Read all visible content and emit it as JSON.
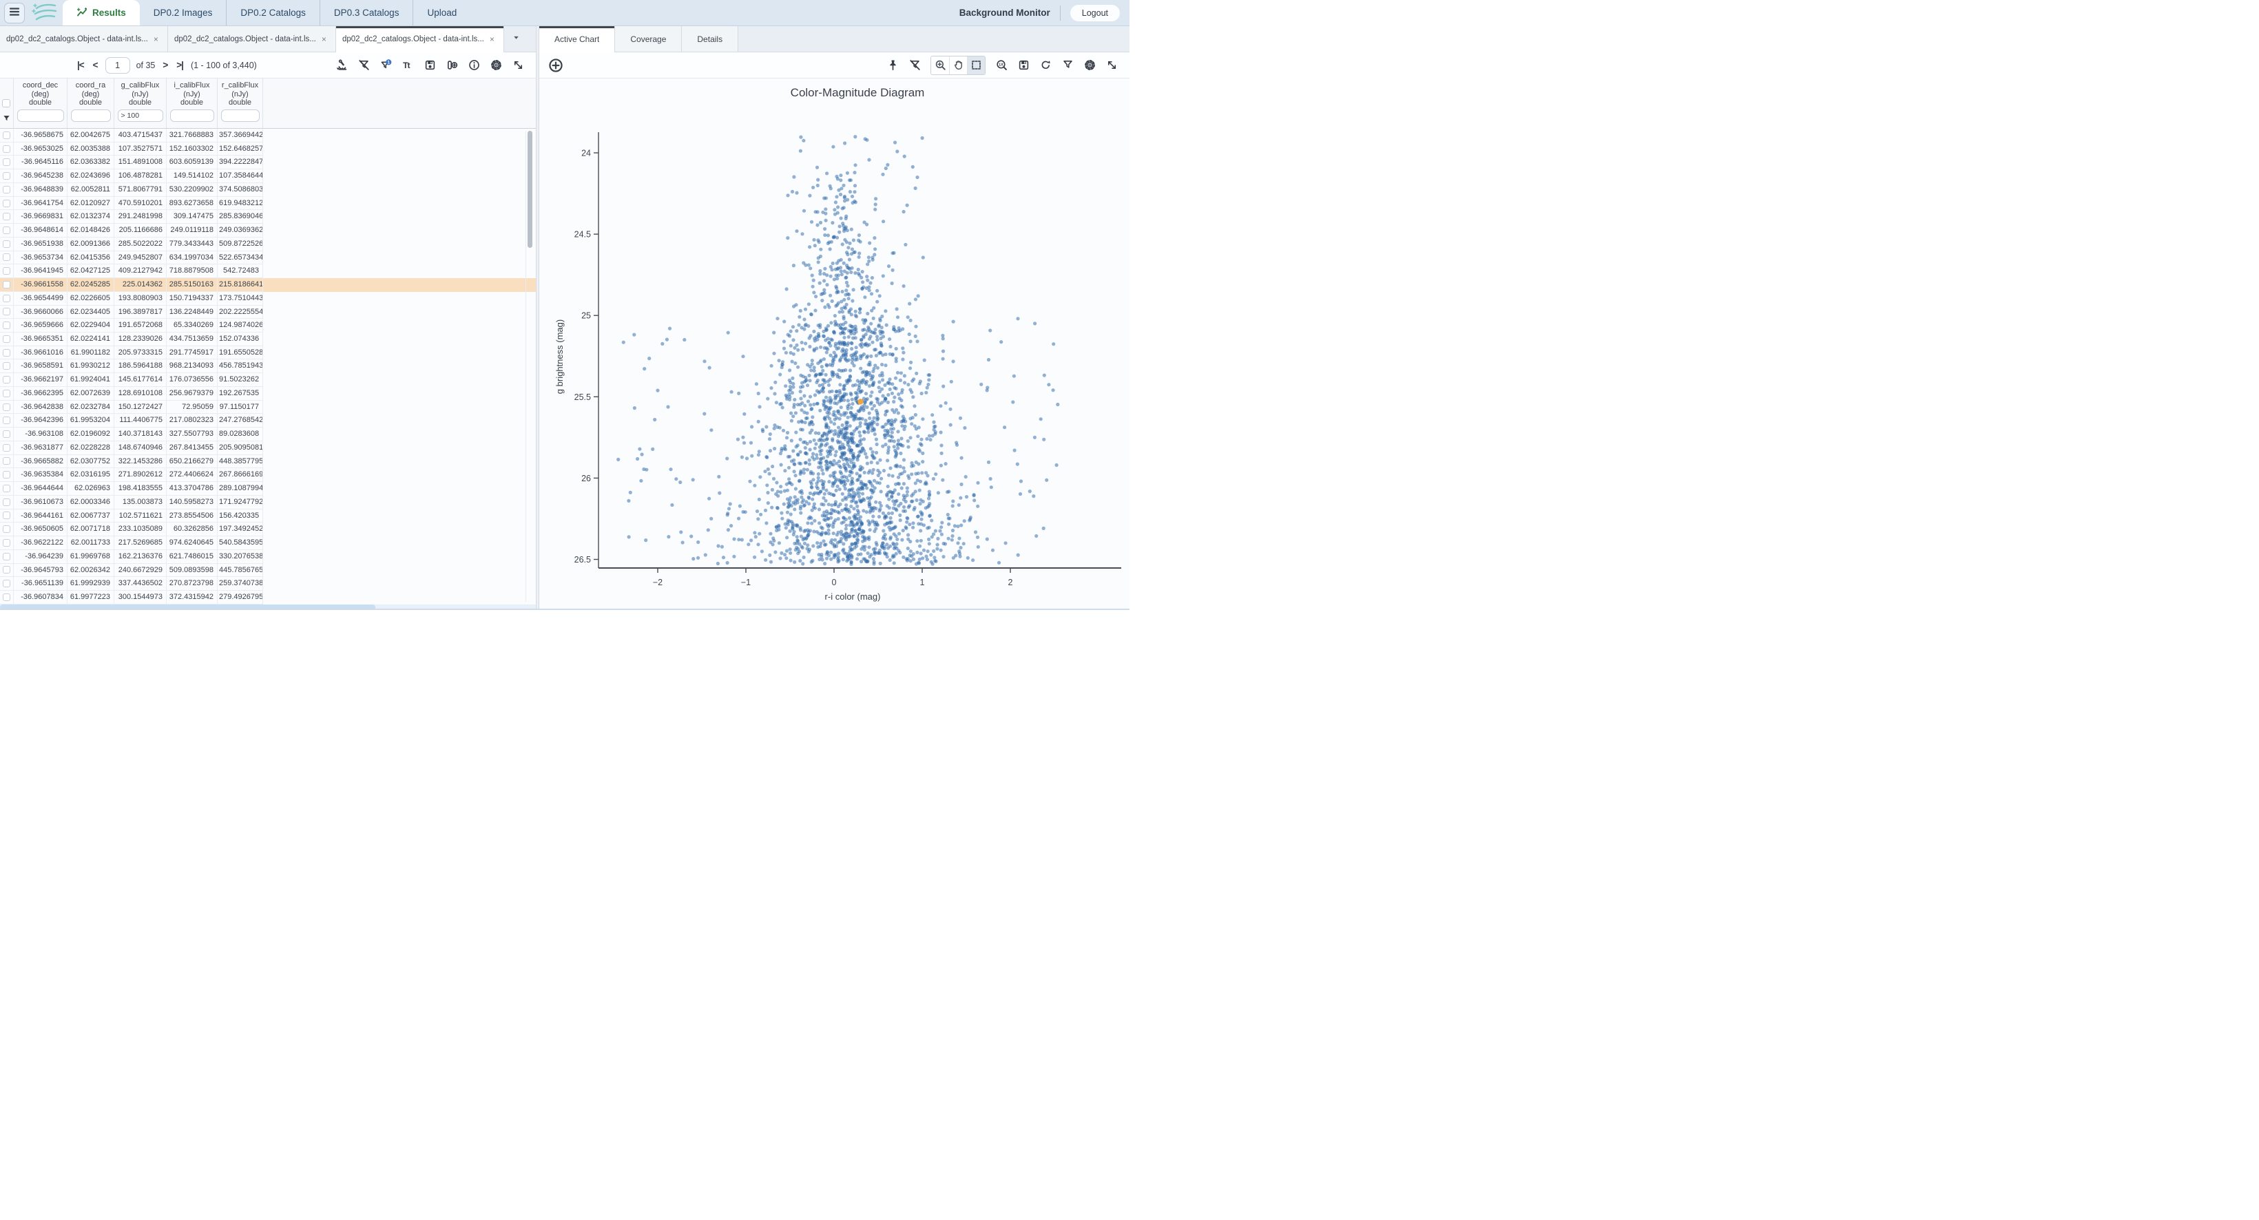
{
  "header": {
    "tabs": [
      {
        "label": "Results",
        "active": true,
        "icon": "results"
      },
      {
        "label": "DP0.2 Images",
        "active": false
      },
      {
        "label": "DP0.2 Catalogs",
        "active": false
      },
      {
        "label": "DP0.3 Catalogs",
        "active": false
      },
      {
        "label": "Upload",
        "active": false
      }
    ],
    "background_monitor_label": "Background Monitor",
    "logout_label": "Logout"
  },
  "left_panel": {
    "result_tabs": [
      {
        "label": "dp02_dc2_catalogs.Object - data-int.ls...",
        "active": false
      },
      {
        "label": "dp02_dc2_catalogs.Object - data-int.ls...",
        "active": false
      },
      {
        "label": "dp02_dc2_catalogs.Object - data-int.ls...",
        "active": true
      }
    ],
    "pagination": {
      "page": "1",
      "of_label": "of 35",
      "range_label": "(1 - 100 of 3,440)",
      "first_label": "|<",
      "prev_label": "<",
      "next_label": ">",
      "last_label": ">|"
    },
    "toolbar_icons": [
      {
        "name": "analyze-button",
        "kind": "microscope"
      },
      {
        "name": "clear-filters-button",
        "kind": "filter-slash"
      },
      {
        "name": "filters-button",
        "kind": "filter-badge",
        "badge": "1"
      },
      {
        "name": "text-view-button",
        "kind": "text-view"
      },
      {
        "name": "save-table-button",
        "kind": "save"
      },
      {
        "name": "add-column-button",
        "kind": "add-column"
      },
      {
        "name": "table-info-button",
        "kind": "info"
      },
      {
        "name": "table-options-button",
        "kind": "gear"
      },
      {
        "name": "expand-table-button",
        "kind": "expand"
      }
    ],
    "table": {
      "columns": [
        {
          "name": "coord_dec",
          "unit": "(deg)",
          "type": "double",
          "filter": ""
        },
        {
          "name": "coord_ra",
          "unit": "(deg)",
          "type": "double",
          "filter": ""
        },
        {
          "name": "g_calibFlux",
          "unit": "(nJy)",
          "type": "double",
          "filter": "> 100"
        },
        {
          "name": "i_calibFlux",
          "unit": "(nJy)",
          "type": "double",
          "filter": ""
        },
        {
          "name": "r_calibFlux",
          "unit": "(nJy)",
          "type": "double",
          "filter": ""
        }
      ],
      "highlighted_row_index": 11,
      "rows": [
        [
          "-36.9658675",
          "62.0042675",
          "403.4715437",
          "321.7668883",
          "357.3669442"
        ],
        [
          "-36.9653025",
          "62.0035388",
          "107.3527571",
          "152.1603302",
          "152.6468257"
        ],
        [
          "-36.9645116",
          "62.0363382",
          "151.4891008",
          "603.6059139",
          "394.2222847"
        ],
        [
          "-36.9645238",
          "62.0243696",
          "106.4878281",
          "149.514102",
          "107.3584644"
        ],
        [
          "-36.9648839",
          "62.0052811",
          "571.8067791",
          "530.2209902",
          "374.5086803"
        ],
        [
          "-36.9641754",
          "62.0120927",
          "470.5910201",
          "893.6273658",
          "619.9483212"
        ],
        [
          "-36.9669831",
          "62.0132374",
          "291.2481998",
          "309.147475",
          "285.8369046"
        ],
        [
          "-36.9648614",
          "62.0148426",
          "205.1166686",
          "249.0119118",
          "249.0369362"
        ],
        [
          "-36.9651938",
          "62.0091366",
          "285.5022022",
          "779.3433443",
          "509.8722526"
        ],
        [
          "-36.9653734",
          "62.0415356",
          "249.9452807",
          "634.1997034",
          "522.6573434"
        ],
        [
          "-36.9641945",
          "62.0427125",
          "409.2127942",
          "718.8879508",
          "542.72483"
        ],
        [
          "-36.9661558",
          "62.0245285",
          "225.014362",
          "285.5150163",
          "215.8186641"
        ],
        [
          "-36.9654499",
          "62.0226605",
          "193.8080903",
          "150.7194337",
          "173.7510443"
        ],
        [
          "-36.9660066",
          "62.0234405",
          "196.3897817",
          "136.2248449",
          "202.2225554"
        ],
        [
          "-36.9659666",
          "62.0229404",
          "191.6572068",
          "65.3340269",
          "124.9874026"
        ],
        [
          "-36.9665351",
          "62.0224141",
          "128.2339026",
          "434.7513659",
          "152.074336"
        ],
        [
          "-36.9661016",
          "61.9901182",
          "205.9733315",
          "291.7745917",
          "191.6550528"
        ],
        [
          "-36.9658591",
          "61.9930212",
          "186.5964188",
          "968.2134093",
          "456.7851943"
        ],
        [
          "-36.9662197",
          "61.9924041",
          "145.6177614",
          "176.0736556",
          "91.5023262"
        ],
        [
          "-36.9662395",
          "62.0072639",
          "128.6910108",
          "256.9679379",
          "192.267535"
        ],
        [
          "-36.9642838",
          "62.0232784",
          "150.1272427",
          "72.95059",
          "97.1150177"
        ],
        [
          "-36.9642396",
          "61.9953204",
          "111.4406775",
          "217.0802323",
          "247.2768542"
        ],
        [
          "-36.963108",
          "62.0196092",
          "140.3718143",
          "327.5507793",
          "89.0283608"
        ],
        [
          "-36.9631877",
          "62.0228228",
          "148.6740946",
          "267.8413455",
          "205.9095081"
        ],
        [
          "-36.9665882",
          "62.0307752",
          "322.1453286",
          "650.2166279",
          "448.3857795"
        ],
        [
          "-36.9635384",
          "62.0316195",
          "271.8902612",
          "272.4406624",
          "267.8666169"
        ],
        [
          "-36.9644644",
          "62.026963",
          "198.4183555",
          "413.3704786",
          "289.1087994"
        ],
        [
          "-36.9610673",
          "62.0003346",
          "135.003873",
          "140.5958273",
          "171.9247792"
        ],
        [
          "-36.9644161",
          "62.0067737",
          "102.5711621",
          "273.8554506",
          "156.420335"
        ],
        [
          "-36.9650605",
          "62.0071718",
          "233.1035089",
          "60.3262856",
          "197.3492452"
        ],
        [
          "-36.9622122",
          "62.0011733",
          "217.5269685",
          "974.6240645",
          "540.5843595"
        ],
        [
          "-36.964239",
          "61.9969768",
          "162.2136376",
          "621.7486015",
          "330.2076538"
        ],
        [
          "-36.9645793",
          "62.0026342",
          "240.6672929",
          "509.0893598",
          "445.7856765"
        ],
        [
          "-36.9651139",
          "61.9992939",
          "337.4436502",
          "270.8723798",
          "259.3740738"
        ],
        [
          "-36.9607834",
          "61.9977223",
          "300.1544973",
          "372.4315942",
          "279.4926795"
        ]
      ]
    }
  },
  "right_panel": {
    "tabs": [
      {
        "label": "Active Chart",
        "active": true
      },
      {
        "label": "Coverage",
        "active": false
      },
      {
        "label": "Details",
        "active": false
      }
    ],
    "toolbar_icons": [
      {
        "name": "pin-chart-button",
        "kind": "pin"
      },
      {
        "name": "clear-chart-filters-button",
        "kind": "filter-slash"
      },
      {
        "name": "zoom-mode-button",
        "kind": "zoom-in",
        "group": true,
        "selected": false
      },
      {
        "name": "pan-mode-button",
        "kind": "pan-hand",
        "group": true,
        "selected": false
      },
      {
        "name": "select-mode-button",
        "kind": "select-rect",
        "group": true,
        "selected": true
      },
      {
        "name": "zoom-original-button",
        "kind": "zoom-1x"
      },
      {
        "name": "save-chart-button",
        "kind": "save"
      },
      {
        "name": "restore-chart-button",
        "kind": "rotate"
      },
      {
        "name": "chart-filter-button",
        "kind": "filter"
      },
      {
        "name": "chart-options-button",
        "kind": "gear"
      },
      {
        "name": "expand-chart-button",
        "kind": "expand"
      }
    ],
    "add_chart_icon": {
      "name": "add-chart-button",
      "kind": "plus-circle"
    }
  },
  "chart_data": {
    "type": "scatter",
    "title": "Color-Magnitude Diagram",
    "xlabel": "r-i color (mag)",
    "ylabel": "g brightness (mag)",
    "x_ticks": [
      -2,
      -1,
      0,
      1,
      2
    ],
    "y_ticks": [
      24,
      24.5,
      25,
      25.5,
      26,
      26.5
    ],
    "xlim": [
      -2.67,
      3.26
    ],
    "ylim_top_to_bottom": [
      23.89,
      26.55
    ],
    "y_axis_inverted": true,
    "grid": false,
    "legend": "none",
    "marker_color": "#2f6aa8",
    "marker_opacity": 0.52,
    "marker_radius": 2.6,
    "point_count_approx": 2350,
    "highlight_point": {
      "x": 0.3,
      "y": 25.53,
      "color": "#f2a43d",
      "radius": 4.2
    },
    "generator": {
      "seed": 20240217,
      "n": 2350,
      "xclip": [
        -2.55,
        2.75
      ],
      "yclip": [
        23.88,
        26.53
      ],
      "components": [
        {
          "type": "cone",
          "frac": 0.6,
          "y0": 24.02,
          "yspan": 2.5,
          "ypow": 0.5,
          "cx0": 0.06,
          "cxSlope": 0.075,
          "sx0": 0.085,
          "sxSlope": 0.21
        },
        {
          "type": "cloud",
          "frac": 0.3,
          "ymin": 25.05,
          "yspan": 1.48,
          "cx": 0.22,
          "sx0": 0.38,
          "sxSlope": 0.22
        },
        {
          "type": "wide",
          "frac": 0.075,
          "ymin": 25.0,
          "yspan": 1.53,
          "xmin": -2.45,
          "xmax": 2.55
        },
        {
          "type": "top",
          "frac": 0.025,
          "ymin": 23.9,
          "yspan": 1.1,
          "xmin": -0.55,
          "xmax": 1.05
        }
      ]
    },
    "colors": {
      "accent_blue": "#3f74c9",
      "highlight_orange": "#f9dfbf",
      "tab_green": "#2e7d3e"
    }
  }
}
